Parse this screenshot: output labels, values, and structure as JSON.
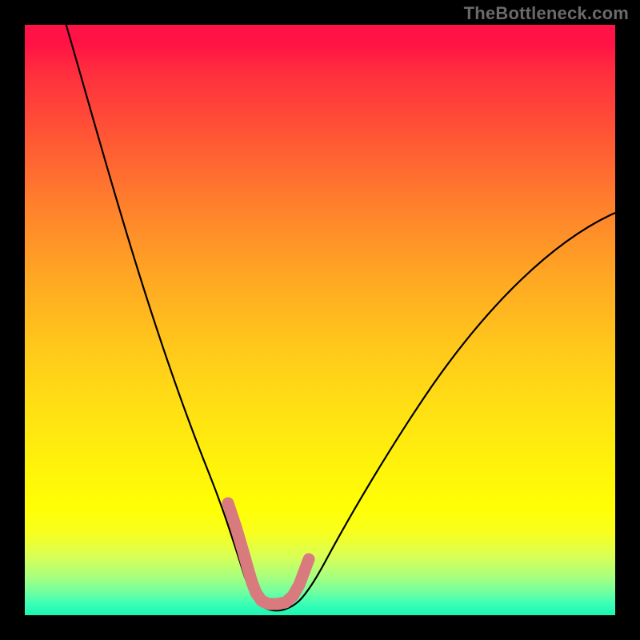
{
  "watermark": {
    "text": "TheBottleneck.com"
  },
  "chart_data": {
    "type": "line",
    "title": "",
    "xlabel": "",
    "ylabel": "",
    "xlim": [
      0,
      100
    ],
    "ylim": [
      0,
      100
    ],
    "grid": false,
    "legend": false,
    "series": [
      {
        "name": "bottleneck-curve",
        "color": "#000000",
        "x": [
          7,
          10,
          13,
          16,
          19,
          22,
          25,
          28,
          31,
          33,
          35,
          37,
          39,
          41,
          43,
          45,
          47,
          50,
          55,
          60,
          65,
          70,
          75,
          80,
          85,
          90,
          95,
          100
        ],
        "y": [
          100,
          91,
          82,
          73,
          64,
          55,
          46,
          37,
          28,
          22,
          16,
          11,
          7,
          4,
          2,
          2,
          3,
          6,
          12,
          19,
          26,
          33,
          40,
          46,
          52,
          58,
          63,
          68
        ]
      },
      {
        "name": "optimal-band",
        "color": "#d87a7e",
        "x": [
          34.5,
          35.5,
          36.5,
          37.5,
          38.5,
          39.5,
          40.5,
          41.5,
          42.5,
          43.5,
          44.5,
          45.5,
          46.5,
          47.5
        ],
        "y": [
          18,
          14,
          10.5,
          7.5,
          5,
          3.5,
          2.5,
          2,
          2,
          2.5,
          3,
          4.5,
          6.5,
          9
        ]
      }
    ],
    "gradient_stops": [
      {
        "pos": 0.0,
        "color": "#ff1245"
      },
      {
        "pos": 0.5,
        "color": "#ffe213"
      },
      {
        "pos": 0.85,
        "color": "#ffff05"
      },
      {
        "pos": 1.0,
        "color": "#19f7b2"
      }
    ]
  }
}
